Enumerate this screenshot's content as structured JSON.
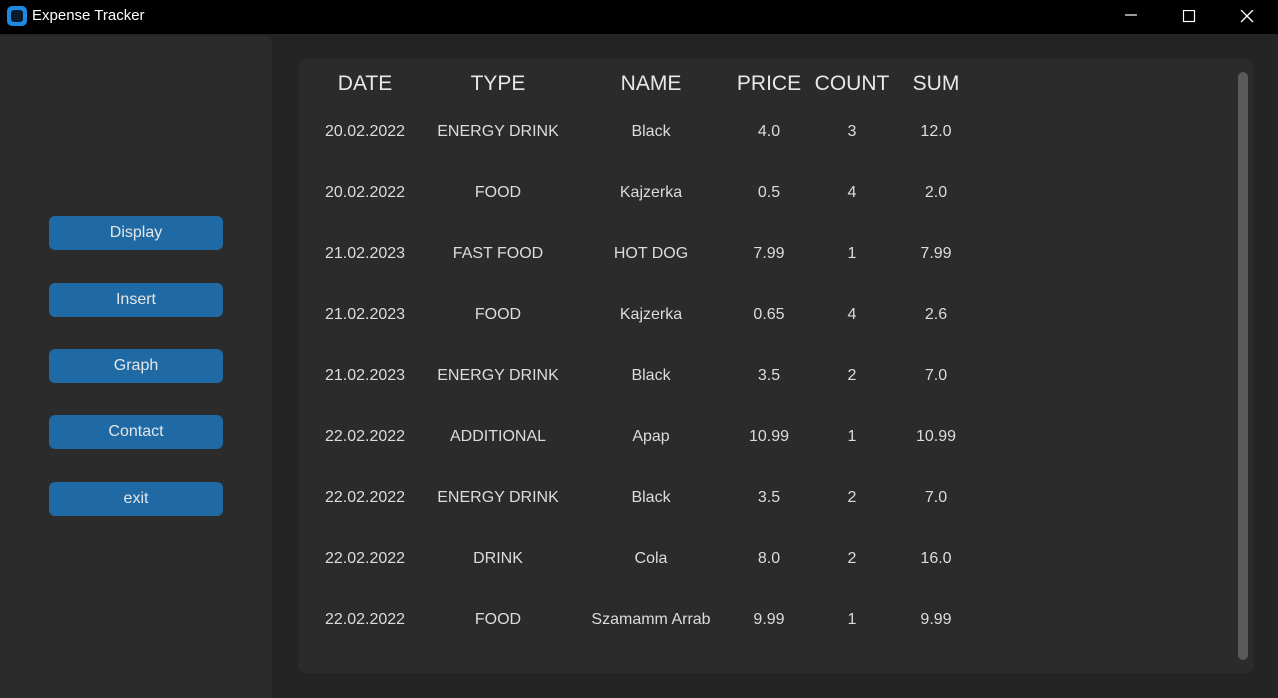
{
  "window": {
    "title": "Expense Tracker",
    "icon": "app-logo-icon"
  },
  "sidebar": {
    "buttons": [
      {
        "label": "Display"
      },
      {
        "label": "Insert"
      },
      {
        "label": "Graph"
      },
      {
        "label": "Contact"
      },
      {
        "label": "exit"
      }
    ]
  },
  "table": {
    "headers": [
      "DATE",
      "TYPE",
      "NAME",
      "PRICE",
      "COUNT",
      "SUM"
    ],
    "rows": [
      [
        "20.02.2022",
        "ENERGY DRINK",
        "Black",
        "4.0",
        "3",
        "12.0"
      ],
      [
        "20.02.2022",
        "FOOD",
        "Kajzerka",
        "0.5",
        "4",
        "2.0"
      ],
      [
        "21.02.2023",
        "FAST FOOD",
        "HOT DOG",
        "7.99",
        "1",
        "7.99"
      ],
      [
        "21.02.2023",
        "FOOD",
        "Kajzerka",
        "0.65",
        "4",
        "2.6"
      ],
      [
        "21.02.2023",
        "ENERGY DRINK",
        "Black",
        "3.5",
        "2",
        "7.0"
      ],
      [
        "22.02.2022",
        "ADDITIONAL",
        "Apap",
        "10.99",
        "1",
        "10.99"
      ],
      [
        "22.02.2022",
        "ENERGY DRINK",
        "Black",
        "3.5",
        "2",
        "7.0"
      ],
      [
        "22.02.2022",
        "DRINK",
        "Cola",
        "8.0",
        "2",
        "16.0"
      ],
      [
        "22.02.2022",
        "FOOD",
        "Szamamm Arrab",
        "9.99",
        "1",
        "9.99"
      ]
    ]
  },
  "colors": {
    "accent": "#1f6aa5",
    "background": "#242424",
    "panel": "#2b2b2b",
    "titlebar": "#000000"
  }
}
